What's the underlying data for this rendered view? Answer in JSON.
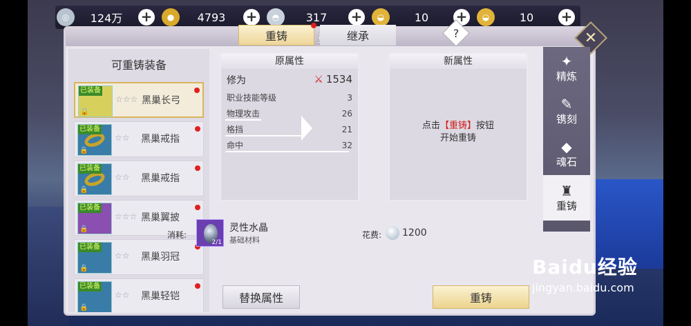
{
  "currencies": [
    {
      "icon": "silver-coin-icon",
      "symbol": "◎",
      "value": "124万",
      "color": "#b7c3cf"
    },
    {
      "icon": "gold-coin-icon",
      "symbol": "●",
      "value": "4793",
      "color": "#d8a92a"
    },
    {
      "icon": "silver-ingot-icon",
      "symbol": "◓",
      "value": "317",
      "color": "#c9d2dc"
    },
    {
      "icon": "gold-ingot-icon",
      "symbol": "◒",
      "value": "10",
      "color": "#e0b43a"
    },
    {
      "icon": "gold-ingot-icon",
      "symbol": "◒",
      "value": "10",
      "color": "#e0b43a"
    }
  ],
  "plus_symbol": "+",
  "panel": {
    "title": "重铸",
    "close_symbol": "✕"
  },
  "left": {
    "title": "可重铸装备",
    "items": [
      {
        "name": "黑巢长弓",
        "stars": "☆☆☆",
        "badge": "已装备",
        "lock": "🔒",
        "icon_bg": "#d7d05c"
      },
      {
        "name": "黑巢戒指",
        "stars": "☆☆",
        "badge": "已装备",
        "lock": "🔒",
        "icon_bg": "#3a7ca8"
      },
      {
        "name": "黑巢戒指",
        "stars": "☆☆",
        "badge": "已装备",
        "lock": "🔒",
        "icon_bg": "#3a7ca8"
      },
      {
        "name": "黑巢翼披",
        "stars": "☆☆☆",
        "badge": "已装备",
        "lock": "🔒",
        "icon_bg": "#8a4fb0"
      },
      {
        "name": "黑巢羽冠",
        "stars": "☆☆",
        "badge": "已装备",
        "lock": "🔒",
        "icon_bg": "#3a7ca8"
      },
      {
        "name": "黑巢轻铠",
        "stars": "☆☆",
        "badge": "已装备",
        "lock": "🔒",
        "icon_bg": "#3a7ca8"
      }
    ]
  },
  "tabs": [
    {
      "label": "重铸"
    },
    {
      "label": "继承"
    }
  ],
  "help_symbol": "?",
  "original": {
    "title": "原属性",
    "power_label": "修为",
    "power_symbol": "⚔",
    "power_value": "1534",
    "rows": [
      {
        "label": "职业技能等级",
        "value": "3",
        "fill": 0
      },
      {
        "label": "物理攻击",
        "value": "26",
        "fill": 0.28
      },
      {
        "label": "格挡",
        "value": "21",
        "fill": 0.6
      },
      {
        "label": "命中",
        "value": "32",
        "fill": 0.96
      }
    ]
  },
  "new_attr": {
    "title": "新属性",
    "hint_pre": "点击",
    "hint_btn": "【重铸】",
    "hint_post": "按钮",
    "hint_line2": "开始重铸"
  },
  "cost": {
    "label": "消耗:",
    "material_name": "灵性水晶",
    "material_type": "基础材料",
    "material_qty": "2/1",
    "fee_label": "花费:",
    "fee_value": "1200"
  },
  "buttons": {
    "swap": "替换属性",
    "reforge": "重铸"
  },
  "sidenav": [
    {
      "label": "精炼",
      "symbol": "✦",
      "icon": "refine-icon"
    },
    {
      "label": "镌刻",
      "symbol": "✎",
      "icon": "engrave-icon"
    },
    {
      "label": "魂石",
      "symbol": "◆",
      "icon": "soulstone-icon"
    },
    {
      "label": "重铸",
      "symbol": "♜",
      "icon": "reforge-icon"
    }
  ],
  "watermark": {
    "big": "Baidu经验",
    "small": "jingyan.baidu.com"
  }
}
